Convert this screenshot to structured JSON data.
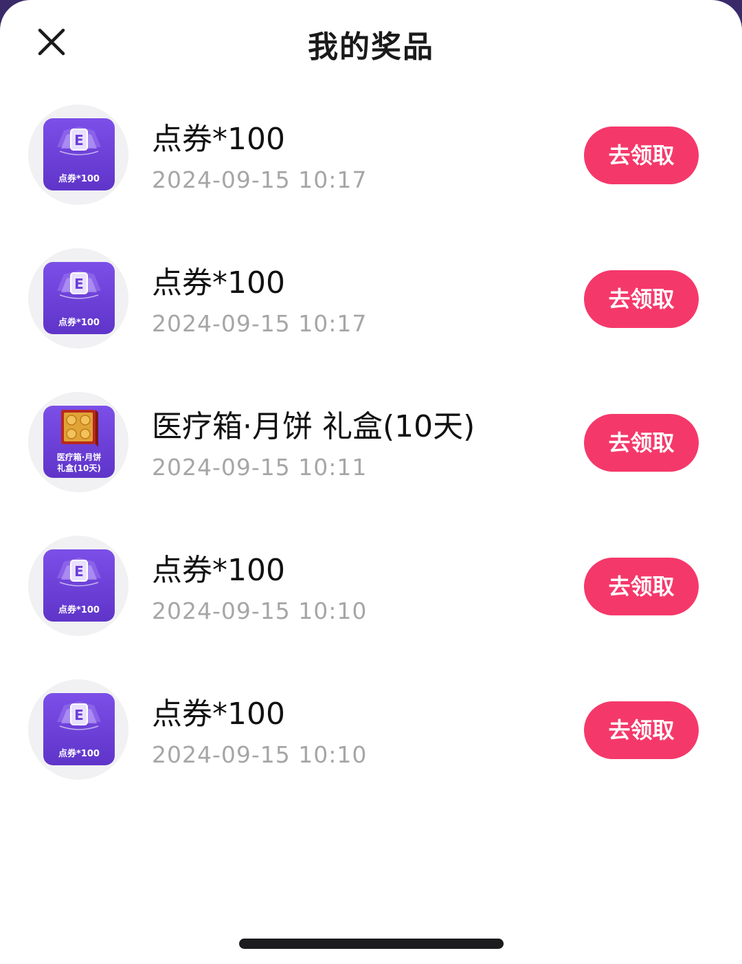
{
  "header": {
    "title": "我的奖品",
    "close_icon": "close-icon"
  },
  "prizes": [
    {
      "name": "点券*100",
      "time": "2024-09-15 10:17",
      "thumb_label": "点券*100",
      "thumb_type": "voucher",
      "button_label": "去领取"
    },
    {
      "name": "点券*100",
      "time": "2024-09-15 10:17",
      "thumb_label": "点券*100",
      "thumb_type": "voucher",
      "button_label": "去领取"
    },
    {
      "name": "医疗箱·月饼 礼盒(10天)",
      "time": "2024-09-15 10:11",
      "thumb_label_line1": "医疗箱·月饼",
      "thumb_label_line2": "礼盒(10天)",
      "thumb_type": "mooncake-box",
      "button_label": "去领取"
    },
    {
      "name": "点券*100",
      "time": "2024-09-15 10:10",
      "thumb_label": "点券*100",
      "thumb_type": "voucher",
      "button_label": "去领取"
    },
    {
      "name": "点券*100",
      "time": "2024-09-15 10:10",
      "thumb_label": "点券*100",
      "thumb_type": "voucher",
      "button_label": "去领取"
    }
  ],
  "colors": {
    "accent_button": "#f5386a",
    "thumb_purple": "#6a3fd6",
    "timestamp_gray": "#a6a6a6"
  }
}
